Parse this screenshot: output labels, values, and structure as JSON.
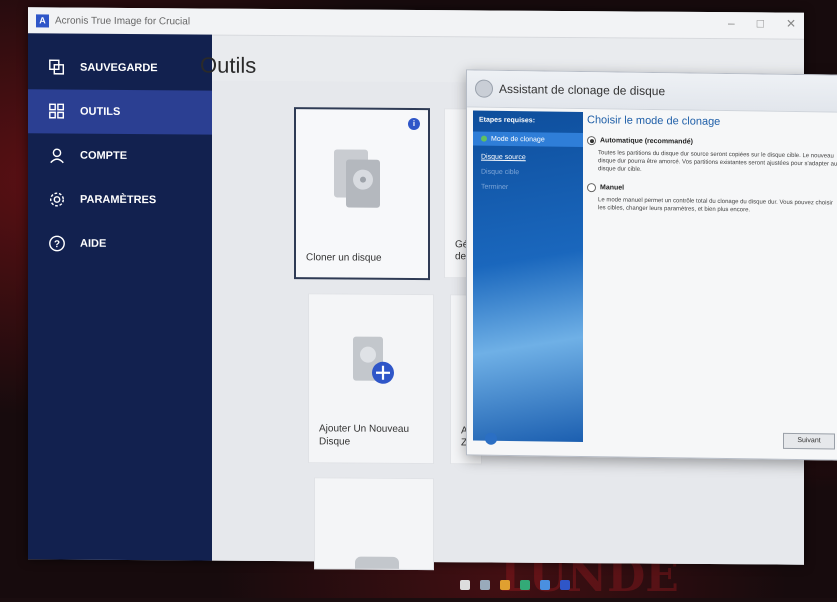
{
  "app": {
    "title": "Acronis True Image for Crucial"
  },
  "sidebar": {
    "items": [
      {
        "label": "SAUVEGARDE"
      },
      {
        "label": "OUTILS"
      },
      {
        "label": "COMPTE"
      },
      {
        "label": "PARAMÈTRES"
      },
      {
        "label": "AIDE"
      }
    ]
  },
  "main": {
    "title": "Outils",
    "tiles": [
      {
        "label": "Cloner un disque"
      },
      {
        "label": "Gé de"
      },
      {
        "label": "Ajouter Un Nouveau Disque"
      },
      {
        "label": "Acr Zo"
      }
    ]
  },
  "wizard": {
    "title": "Assistant de clonage de disque",
    "steps_title": "Etapes requises:",
    "steps": [
      {
        "label": "Mode de clonage"
      },
      {
        "label": "Disque source"
      },
      {
        "label": "Disque cible"
      },
      {
        "label": "Terminer"
      }
    ],
    "right_title": "Choisir le mode de clonage",
    "options": [
      {
        "label": "Automatique (recommandé)",
        "desc": "Toutes les partitions du disque dur source seront copiées sur le disque cible. Le nouveau disque dur pourra être amorcé. Vos partitions existantes seront ajustées pour s'adapter au disque dur cible."
      },
      {
        "label": "Manuel",
        "desc": "Le mode manuel permet un contrôle total du clonage du disque dur. Vous pouvez choisir les cibles, changer leurs paramètres, et bien plus encore."
      }
    ],
    "next_button": "Suivant"
  },
  "colors": {
    "sidebar": "#12214f",
    "active": "#2b3f92",
    "accent": "#2f56c8"
  }
}
